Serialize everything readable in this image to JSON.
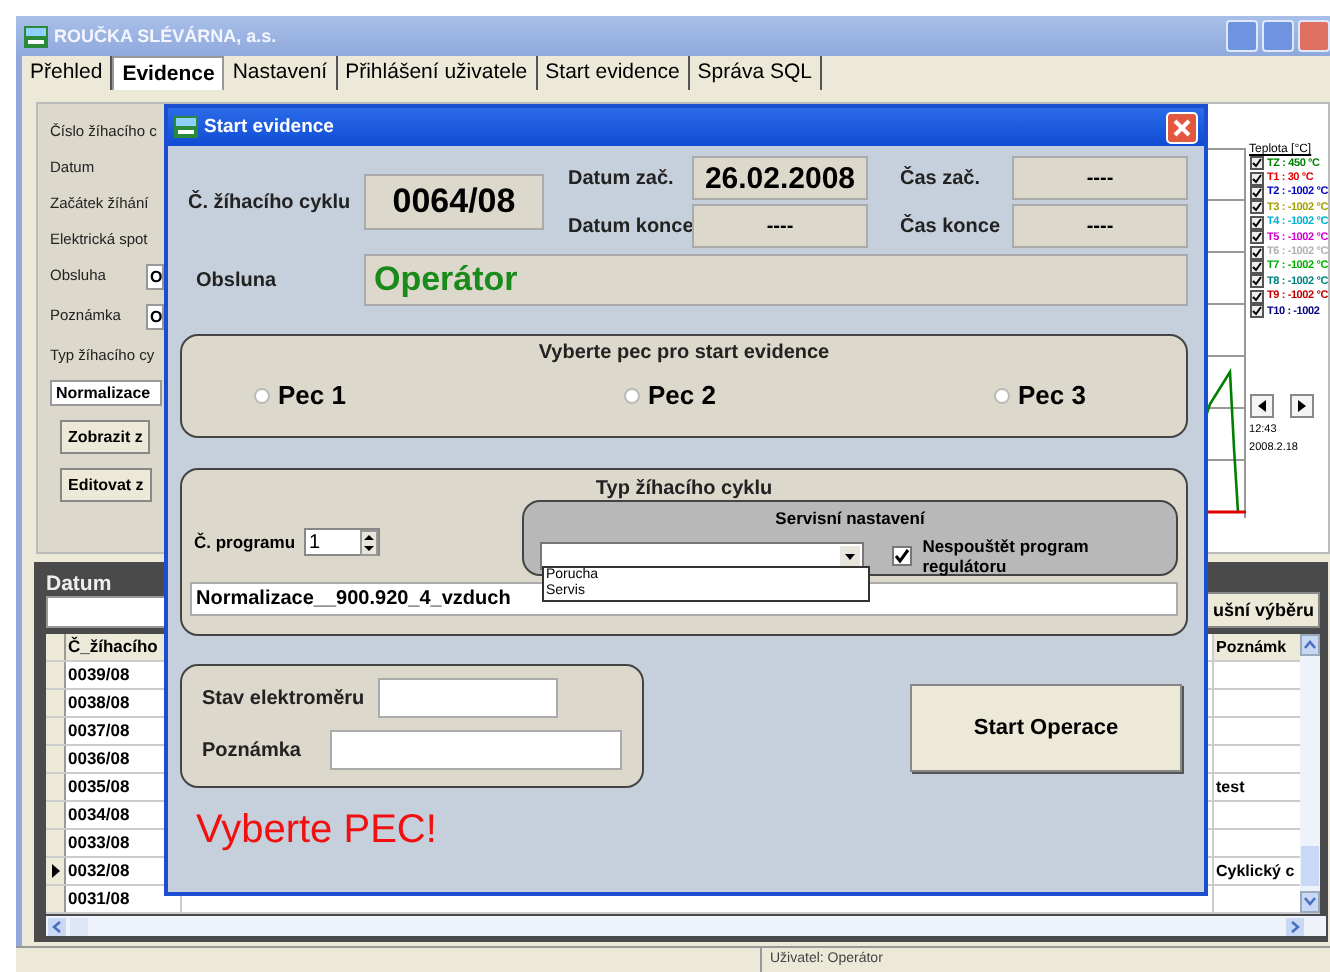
{
  "window": {
    "title": "ROUČKA SLÉVÁRNA, a.s."
  },
  "tabs": [
    {
      "label": "Přehled",
      "selected": false
    },
    {
      "label": "Evidence",
      "selected": true
    },
    {
      "label": "Nastavení",
      "selected": false
    },
    {
      "label": "Přihlášení uživatele",
      "selected": false
    },
    {
      "label": "Start evidence",
      "selected": false
    },
    {
      "label": "Správa SQL",
      "selected": false
    }
  ],
  "form": {
    "labels": [
      "Číslo žíhacího c",
      "Datum",
      "Začátek žíhání",
      "Elektrická spot"
    ],
    "fields": [
      {
        "label": "Obsluha",
        "value": "O"
      },
      {
        "label": "Poznámka",
        "value": "O"
      }
    ],
    "type_label": "Typ žíhacího cy",
    "type_value": "Normalizace",
    "buttons": [
      "Zobrazit z",
      "Editovat z"
    ]
  },
  "chart": {
    "legend_title": "Teplota [°C]",
    "legend": [
      {
        "label": "TZ : 450 °C",
        "color": "#008000",
        "checked": true
      },
      {
        "label": "T1 : 30 °C",
        "color": "#e00000",
        "checked": true
      },
      {
        "label": "T2 : -1002 °C",
        "color": "#0000c0",
        "checked": true
      },
      {
        "label": "T3 : -1002 °C",
        "color": "#a0a000",
        "checked": true
      },
      {
        "label": "T4 : -1002 °C",
        "color": "#00b0d0",
        "checked": true
      },
      {
        "label": "T5 : -1002 °C",
        "color": "#d000d0",
        "checked": true
      },
      {
        "label": "T6 : -1002 °C",
        "color": "#b0b0b0",
        "checked": true
      },
      {
        "label": "T7 : -1002 °C",
        "color": "#00b000",
        "checked": true
      },
      {
        "label": "T8 : -1002 °C",
        "color": "#008080",
        "checked": true
      },
      {
        "label": "T9 : -1002 °C",
        "color": "#c00000",
        "checked": true
      },
      {
        "label": "T10 : -1002",
        "color": "#000080",
        "checked": true
      }
    ],
    "time_label": "12:43",
    "date_label": "2008.2.18"
  },
  "grid": {
    "filter_label": "Datum",
    "filter_button": "ušní výběru",
    "columns": [
      "Č_žíhacího",
      "Poznámk"
    ],
    "rows": [
      {
        "id": "0039/08",
        "selected": false
      },
      {
        "id": "0038/08",
        "selected": false
      },
      {
        "id": "0037/08",
        "selected": false
      },
      {
        "id": "0036/08",
        "selected": false
      },
      {
        "id": "0035/08",
        "note": "test",
        "selected": false
      },
      {
        "id": "0034/08",
        "selected": false
      },
      {
        "id": "0033/08",
        "selected": false
      },
      {
        "id": "0032/08",
        "note": "Cyklický c",
        "selected": true
      },
      {
        "id": "0031/08",
        "selected": false
      }
    ]
  },
  "status_bar": {
    "user": "Uživatel: Operátor"
  },
  "dialog": {
    "title": "Start evidence",
    "cycle_label": "Č. žíhacího cyklu",
    "cycle": "0064/08",
    "date_start_label": "Datum zač.",
    "date_start": "26.02.2008",
    "date_end_label": "Datum konce",
    "date_end": "----",
    "time_start_label": "Čas zač.",
    "time_start": "----",
    "time_end_label": "Čas konce",
    "time_end": "----",
    "operator_label": "Obsluna",
    "operator": "Operátor",
    "furnace_title": "Vyberte pec pro start evidence",
    "furnaces": [
      {
        "label": "Pec 1",
        "selected": false
      },
      {
        "label": "Pec 2",
        "selected": false
      },
      {
        "label": "Pec 3",
        "selected": false
      }
    ],
    "type_title": "Typ žíhacího cyklu",
    "program_label": "Č. programu",
    "program": "1",
    "service_title": "Servisní nastavení",
    "service_options": [
      "Porucha",
      "Servis"
    ],
    "no_start": {
      "label": "Nespouštět program regulátoru",
      "checked": true
    },
    "program_name": "Normalizace__900.920_4_vzduch",
    "meter_label": "Stav elektroměru",
    "note_label": "Poznámka",
    "start_button": "Start Operace",
    "warning": "Vyberte PEC!"
  }
}
